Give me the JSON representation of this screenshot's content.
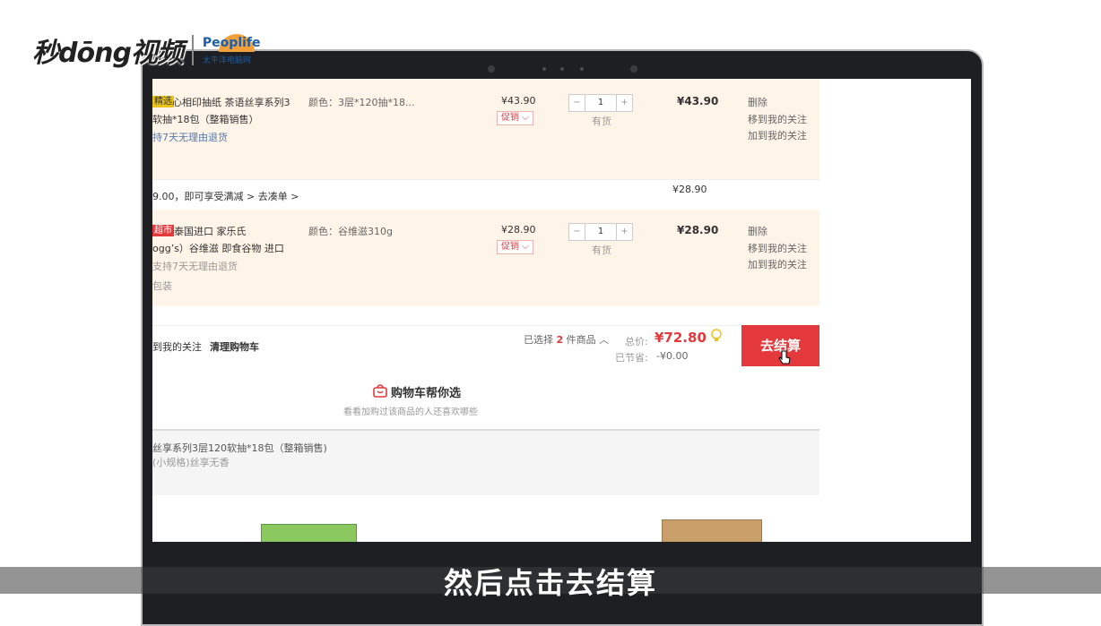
{
  "watermark": {
    "brand": "秒dōng视频",
    "partner_logo": "Peoplife",
    "partner_sub": "太平洋电脑网"
  },
  "cart": {
    "items": [
      {
        "store_tag": "精选",
        "name_line1": "心相印抽纸 茶语丝享系列3",
        "name_line2": "软抽*18包（整箱销售）",
        "return_policy": "持7天无理由退货",
        "spec": "颜色：3层*120抽*18...",
        "price": "¥43.90",
        "promo_label": "促销 ⌵",
        "quantity": "1",
        "stock": "有货",
        "subtotal": "¥43.90",
        "actions": [
          "删除",
          "移到我的关注",
          "加到我的关注"
        ]
      },
      {
        "store_tag": "超市",
        "name_line1": "泰国进口 家乐氏",
        "name_line2": "ogg’s）谷维滋 即食谷物 进口",
        "return_policy": "支持7天无理由退货",
        "packaging": "包装",
        "spec": "颜色：谷维滋310g",
        "price": "¥28.90",
        "promo_label": "促销 ⌵",
        "quantity": "1",
        "stock": "有货",
        "subtotal": "¥28.90",
        "actions": [
          "删除",
          "移到我的关注",
          "加到我的关注"
        ]
      }
    ],
    "promo_bar": {
      "text": "9.00，即可享受满减 >   去凑单 >",
      "amount": "¥28.90"
    },
    "qty_minus": "−",
    "qty_plus": "+"
  },
  "summary": {
    "move_to_follow": "到我的关注",
    "clear_cart": "清理购物车",
    "selected_prefix": "已选择",
    "selected_count": "2",
    "selected_suffix": "件商品 ︿",
    "total_label": "总价:",
    "total_value": "¥72.80",
    "saved_label": "已节省:",
    "saved_value": "-¥0.00",
    "checkout_label": "去结算"
  },
  "recommend": {
    "title": "购物车帮你选",
    "subtitle": "看看加购过该商品的人还喜欢哪些",
    "item_line1": "丝享系列3层120软抽*18包（整箱销售)",
    "item_line2": "(小规格)丝享无香"
  },
  "subtitle": "然后点击去结算",
  "colors": {
    "accent": "#e4393c",
    "row_bg": "#fff4e8",
    "bezel": "#1e1f22"
  }
}
